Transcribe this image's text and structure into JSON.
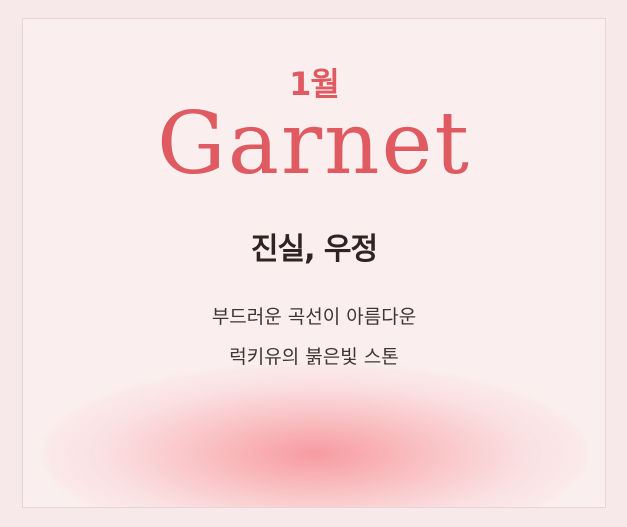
{
  "card": {
    "month": "1월",
    "gem_name": "Garnet",
    "meaning": "진실, 우정",
    "description": [
      "부드러운 곡선이 아름다운",
      "럭키유의 붉은빛 스톤"
    ]
  },
  "colors": {
    "accent": "#e05a61",
    "text_dark": "#2f2423",
    "background": "#f7e9ea",
    "glow": "#f6969b"
  }
}
